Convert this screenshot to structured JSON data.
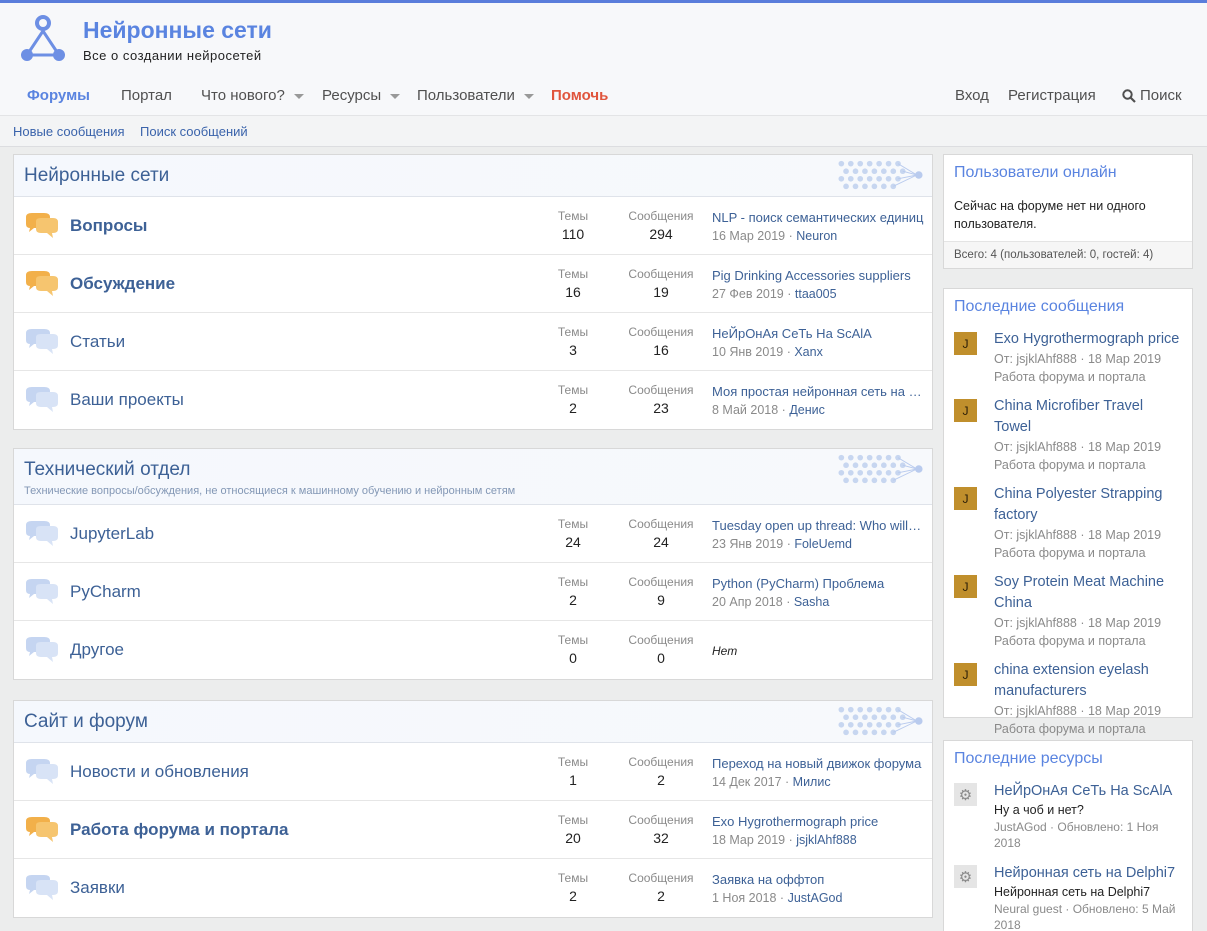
{
  "site": {
    "title": "Нейронные сети",
    "subtitle": "Все о создании нейросетей"
  },
  "nav": {
    "items": [
      {
        "label": "Форумы"
      },
      {
        "label": "Портал"
      },
      {
        "label": "Что нового?"
      },
      {
        "label": "Ресурсы"
      },
      {
        "label": "Пользователи"
      },
      {
        "label": "Помочь"
      }
    ],
    "login": "Вход",
    "register": "Регистрация",
    "search": "Поиск"
  },
  "subnav": {
    "new_posts": "Новые сообщения",
    "search_posts": "Поиск сообщений"
  },
  "labels": {
    "topics": "Темы",
    "messages": "Сообщения",
    "none": "Нет"
  },
  "categories": [
    {
      "title": "Нейронные сети",
      "forums": [
        {
          "name": "Вопросы",
          "topics": "110",
          "messages": "294",
          "last_title": "NLP - поиск семантических единиц",
          "last_date": "16 Мар 2019",
          "last_user": "Neuron"
        },
        {
          "name": "Обсуждение",
          "topics": "16",
          "messages": "19",
          "last_title": "Pig Drinking Accessories suppliers",
          "last_date": "27 Фев 2019",
          "last_user": "ttaa005"
        },
        {
          "name": "Статьи",
          "topics": "3",
          "messages": "16",
          "last_title": "НеЙрОнАя СеТь На ScAlA",
          "last_date": "10 Янв 2019",
          "last_user": "Xanx"
        },
        {
          "name": "Ваши проекты",
          "topics": "2",
          "messages": "23",
          "last_title": "Моя простая нейронная сеть на java",
          "last_date": "8 Май 2018",
          "last_user": "Денис"
        }
      ]
    },
    {
      "title": "Технический отдел",
      "description": "Технические вопросы/обсуждения, не относящиеся к машинному обучению и нейронным сетям",
      "forums": [
        {
          "name": "JupyterLab",
          "topics": "24",
          "messages": "24",
          "last_title": "Tuesday open up thread: Who will be",
          "last_date": "23 Янв 2019",
          "last_user": "FoleUemd"
        },
        {
          "name": "PyCharm",
          "topics": "2",
          "messages": "9",
          "last_title": "Python (PyCharm) Проблема",
          "last_date": "20 Апр 2018",
          "last_user": "Sasha"
        },
        {
          "name": "Другое",
          "topics": "0",
          "messages": "0"
        }
      ]
    },
    {
      "title": "Сайт и форум",
      "forums": [
        {
          "name": "Новости и обновления",
          "topics": "1",
          "messages": "2",
          "last_title": "Переход на новый движок форума",
          "last_date": "14 Дек 2017",
          "last_user": "Милис"
        },
        {
          "name": "Работа форума и портала",
          "topics": "20",
          "messages": "32",
          "last_title": "Exo Hygrothermograph price",
          "last_date": "18 Мар 2019",
          "last_user": "jsjklAhf888"
        },
        {
          "name": "Заявки",
          "topics": "2",
          "messages": "2",
          "last_title": "Заявка на оффтоп",
          "last_date": "1 Ноя 2018",
          "last_user": "JustAGod"
        }
      ]
    }
  ],
  "sidebar": {
    "online": {
      "title": "Пользователи онлайн",
      "text": "Сейчас на форуме нет ни одного пользователя.",
      "footer": "Всего: 4 (пользователей: 0, гостей: 4)"
    },
    "latest_posts": {
      "title": "Последние сообщения",
      "items": [
        {
          "avatar": "J",
          "title": "Exo Hygrothermograph price",
          "meta": "От: jsjklAhf888 · 18 Мар 2019",
          "forum": "Работа форума и портала"
        },
        {
          "avatar": "J",
          "title": "China Microfiber Travel Towel",
          "meta": "От: jsjklAhf888 · 18 Мар 2019",
          "forum": "Работа форума и портала"
        },
        {
          "avatar": "J",
          "title": "China Polyester Strapping factory",
          "meta": "От: jsjklAhf888 · 18 Мар 2019",
          "forum": "Работа форума и портала"
        },
        {
          "avatar": "J",
          "title": "Soy Protein Meat Machine China",
          "meta": "От: jsjklAhf888 · 18 Мар 2019",
          "forum": "Работа форума и портала"
        },
        {
          "avatar": "J",
          "title": "china extension eyelash manufacturers",
          "meta": "От: jsjklAhf888 · 18 Мар 2019",
          "forum": "Работа форума и портала"
        }
      ]
    },
    "latest_resources": {
      "title": "Последние ресурсы",
      "items": [
        {
          "title": "НеЙрОнАя СеТь На ScAlA",
          "desc": "Ну а чоб и нет?",
          "meta": "JustAGod · Обновлено: 1 Ноя 2018"
        },
        {
          "title": "Нейронная сеть на Delphi7",
          "desc": "Нейронная сеть на Delphi7",
          "meta": "Neural guest · Обновлено: 5 Май 2018"
        }
      ]
    }
  },
  "colors": {
    "accent": "#5a84e0",
    "link": "#3d6196",
    "help": "#e0553d",
    "avatar": "#c08f2c"
  }
}
